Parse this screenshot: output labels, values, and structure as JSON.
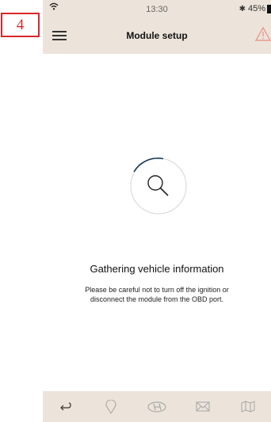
{
  "step_label": "4",
  "status_bar": {
    "time": "13:30",
    "battery": "45%"
  },
  "header": {
    "title": "Module setup"
  },
  "main": {
    "title": "Gathering vehicle information",
    "message_line1": "Please be careful not to turn off the ignition or",
    "message_line2": "disconnect the module from the OBD port."
  },
  "tabs": [
    {
      "icon": "return-arrow-icon"
    },
    {
      "icon": "location-pin-icon"
    },
    {
      "icon": "hyundai-logo-icon"
    },
    {
      "icon": "mail-icon"
    },
    {
      "icon": "map-icon"
    }
  ],
  "colors": {
    "header_bg": "#ece4da",
    "warning": "#e89a8e",
    "annotation": "#d9262b"
  }
}
